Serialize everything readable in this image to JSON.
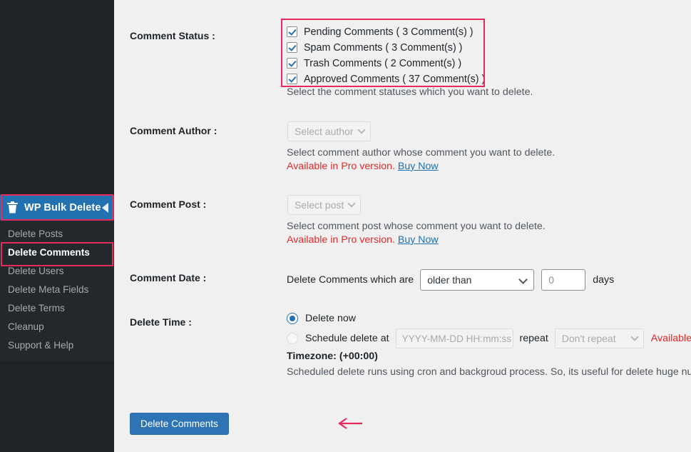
{
  "sidebar": {
    "brand": {
      "label": "WP Bulk Delete",
      "icon": "trash-icon",
      "collapse_icon": "collapse-arrow-icon"
    },
    "items": [
      {
        "label": "Delete Posts",
        "active": false
      },
      {
        "label": "Delete Comments",
        "active": true
      },
      {
        "label": "Delete Users",
        "active": false
      },
      {
        "label": "Delete Meta Fields",
        "active": false
      },
      {
        "label": "Delete Terms",
        "active": false
      },
      {
        "label": "Cleanup",
        "active": false
      },
      {
        "label": "Support & Help",
        "active": false
      }
    ]
  },
  "form": {
    "comment_status": {
      "label": "Comment Status :",
      "options": [
        {
          "label": "Pending Comments ( 3 Comment(s) )",
          "checked": true
        },
        {
          "label": "Spam Comments ( 3 Comment(s) )",
          "checked": true
        },
        {
          "label": "Trash Comments ( 2 Comment(s) )",
          "checked": true
        },
        {
          "label": "Approved Comments ( 37 Comment(s) )",
          "checked": true
        }
      ],
      "help": "Select the comment statuses which you want to delete."
    },
    "comment_author": {
      "label": "Comment Author :",
      "select_value": "Select author",
      "help": "Select comment author whose comment you want to delete.",
      "pro_text": "Available in Pro version.",
      "buy_now": "Buy Now"
    },
    "comment_post": {
      "label": "Comment Post :",
      "select_value": "Select post",
      "help": "Select comment post whose comment you want to delete.",
      "pro_text": "Available in Pro version.",
      "buy_now": "Buy Now"
    },
    "comment_date": {
      "label": "Comment Date :",
      "lead_text": "Delete Comments which are",
      "operator": "older than",
      "days_value": "0",
      "days_unit": "days"
    },
    "delete_time": {
      "label": "Delete Time :",
      "delete_now": "Delete now",
      "schedule_label": "Schedule delete at",
      "schedule_placeholder": "YYYY-MM-DD HH:mm:ss",
      "repeat_label": "repeat",
      "repeat_value": "Don't repeat",
      "available_pro": "Available in P",
      "timezone": "Timezone: (+00:00)",
      "cron_note": "Scheduled delete runs using cron and backgroud process. So, its useful for delete huge num"
    },
    "submit_label": "Delete Comments"
  },
  "colors": {
    "sidebar_bg": "#1d2327",
    "submenu_bg": "#23282d",
    "brand_blue": "#2271b1",
    "annotation_pink": "#e8295c",
    "button_blue": "#2e74b5",
    "pro_red": "#e02b2b",
    "link_blue": "#2271b1",
    "content_bg": "#f0f0f1"
  }
}
